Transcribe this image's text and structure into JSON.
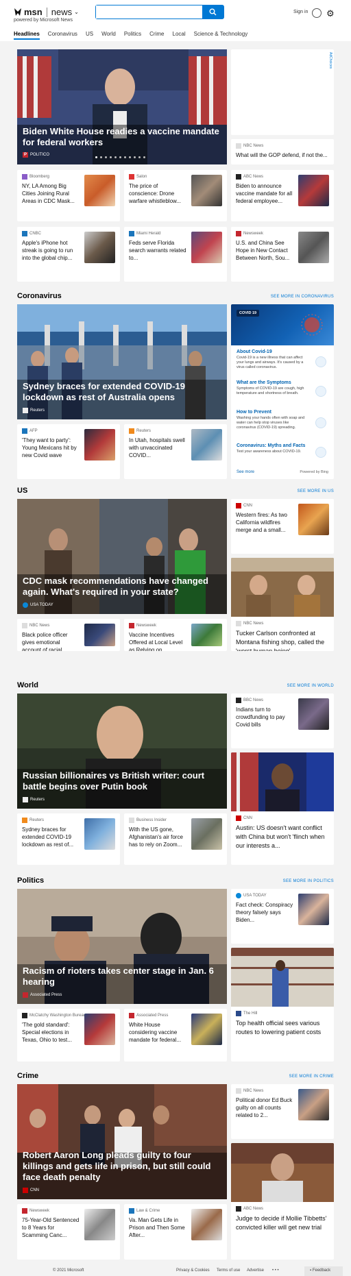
{
  "header": {
    "logo_msn": "msn",
    "logo_news": "news",
    "powered_by": "powered by Microsoft News",
    "search_placeholder": "",
    "signin": "Sign in"
  },
  "nav": [
    "Headlines",
    "Coronavirus",
    "US",
    "World",
    "Politics",
    "Crime",
    "Local",
    "Science & Technology"
  ],
  "ad_label": "AdChoices",
  "headlines": {
    "hero": {
      "title": "Biden White House readies a vaccine mandate for federal workers",
      "source": "POLITICO"
    },
    "right_mid": {
      "source": "NBC News",
      "title": "What will the GOP defend, if not the..."
    },
    "cards": [
      {
        "source": "Bloomberg",
        "title": "NY, LA Among Big Cities Joining Rural Areas in CDC Mask..."
      },
      {
        "source": "Salon",
        "title": "The price of conscience: Drone warfare whistleblow..."
      },
      {
        "source": "ABC News",
        "title": "Biden to announce vaccine mandate for all federal employee..."
      },
      {
        "source": "CNBC",
        "title": "Apple's iPhone hot streak is going to run into the global chip..."
      },
      {
        "source": "Miami Herald",
        "title": "Feds serve Florida search warrants related to..."
      },
      {
        "source": "Newsweek",
        "title": "U.S. and China See Hope in New Contact Between North, Sou..."
      }
    ]
  },
  "coronavirus": {
    "title": "Coronavirus",
    "see_more": "SEE MORE IN CORONAVIRUS",
    "hero": {
      "title": "Sydney braces for extended COVID-19 lockdown as rest of Australia opens",
      "source": "Reuters"
    },
    "cards": [
      {
        "source": "AFP",
        "title": "'They want to party': Young Mexicans hit by new Covid wave"
      },
      {
        "source": "Reuters",
        "title": "In Utah, hospitals swell with unvaccinated COVID..."
      }
    ],
    "panel": {
      "badge": "COVID 19",
      "items": [
        {
          "title": "About Covid-19",
          "desc": "Covid-19 is a new illness that can affect your lungs and airways. It's caused by a virus called coronavirus."
        },
        {
          "title": "What are the Symptoms",
          "desc": "Symptoms of COVID-19 are cough, high temperature and shortness of breath."
        },
        {
          "title": "How to Prevent",
          "desc": "Washing your hands often with soap and water can help stop viruses like coronavirus (COVID-19) spreading."
        },
        {
          "title": "Coronavirus: Myths and Facts",
          "desc": "Test your awareness about COVID-19."
        }
      ],
      "see_more": "See more",
      "powered": "Powered by Bing"
    }
  },
  "us": {
    "title": "US",
    "see_more": "SEE MORE IN US",
    "hero": {
      "title": "CDC mask recommendations have changed again. What's required in your state?",
      "source": "USA TODAY"
    },
    "right_top": {
      "source": "CNN",
      "title": "Western fires: As two California wildfires merge and a small..."
    },
    "right_big": {
      "source": "NBC News",
      "title": "Tucker Carlson confronted at Montana fishing shop, called the 'worst human being'"
    },
    "cards": [
      {
        "source": "NBC News",
        "title": "Black police officer gives emotional account of racial..."
      },
      {
        "source": "Newsweek",
        "title": "Vaccine Incentives Offered at Local Level as Relying on..."
      }
    ]
  },
  "world": {
    "title": "World",
    "see_more": "SEE MORE IN WORLD",
    "hero": {
      "title": "Russian billionaires vs British writer: court battle begins over Putin book",
      "source": "Reuters"
    },
    "right_top": {
      "source": "BBC News",
      "title": "Indians turn to crowdfunding to pay Covid bills"
    },
    "right_big": {
      "source": "CNN",
      "title": "Austin: US doesn't want conflict with China but won't 'flinch when our interests a..."
    },
    "cards": [
      {
        "source": "Reuters",
        "title": "Sydney braces for extended COVID-19 lockdown as rest of..."
      },
      {
        "source": "Business Insider",
        "title": "With the US gone, Afghanistan's air force has to rely on Zoom..."
      }
    ]
  },
  "politics": {
    "title": "Politics",
    "see_more": "SEE MORE IN POLITICS",
    "hero": {
      "title": "Racism of rioters takes center stage in Jan. 6 hearing",
      "source": "Associated Press"
    },
    "right_top": {
      "source": "USA TODAY",
      "title": "Fact check: Conspiracy theory falsely says Biden..."
    },
    "right_big": {
      "source": "The Hill",
      "title": "Top health official sees various routes to lowering patient costs"
    },
    "cards": [
      {
        "source": "McClatchy Washington Bureau",
        "title": "'The gold standard': Special elections in Texas, Ohio to test..."
      },
      {
        "source": "Associated Press",
        "title": "White House considering vaccine mandate for federal..."
      }
    ]
  },
  "crime": {
    "title": "Crime",
    "see_more": "SEE MORE IN CRIME",
    "hero": {
      "title": "Robert Aaron Long pleads guilty to four killings and gets life in prison, but still could face death penalty",
      "source": "CNN"
    },
    "right_top": {
      "source": "NBC News",
      "title": "Political donor Ed Buck guilty on all counts related to 2..."
    },
    "right_big": {
      "source": "ABC News",
      "title": "Judge to decide if Mollie Tibbetts' convicted killer will get new trial"
    },
    "cards": [
      {
        "source": "Newsweek",
        "title": "75-Year-Old Sentenced to 8 Years for Scamming Canc..."
      },
      {
        "source": "Law & Crime",
        "title": "Va. Man Gets Life in Prison and Then Some After..."
      }
    ]
  },
  "footer": {
    "copyright": "© 2021 Microsoft",
    "privacy": "Privacy & Cookies",
    "terms": "Terms of use",
    "advertise": "Advertise",
    "more": "• • •",
    "feedback": "Feedback"
  }
}
